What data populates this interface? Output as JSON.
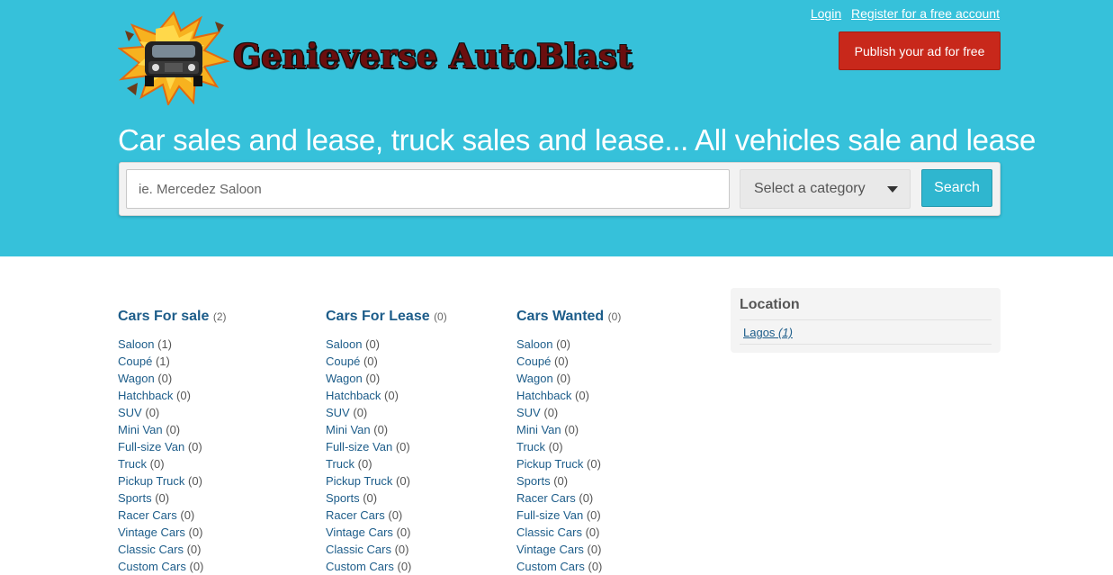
{
  "header": {
    "logo_text": "Genieverse AutoBlast",
    "links": {
      "login": "Login",
      "register": "Register for a free account"
    },
    "publish_label": "Publish your ad for free",
    "tagline": "Car sales and lease, truck sales and lease... All vehicles sale and lease"
  },
  "search": {
    "placeholder": "ie. Mercedez Saloon",
    "category_label": "Select a category",
    "button_label": "Search"
  },
  "categories": [
    {
      "title": "Cars For sale",
      "count": "(2)",
      "items": [
        {
          "label": "Saloon",
          "count": "(1)"
        },
        {
          "label": "Coupé",
          "count": "(1)"
        },
        {
          "label": "Wagon",
          "count": "(0)"
        },
        {
          "label": "Hatchback",
          "count": "(0)"
        },
        {
          "label": "SUV",
          "count": "(0)"
        },
        {
          "label": "Mini Van",
          "count": "(0)"
        },
        {
          "label": "Full-size Van",
          "count": "(0)"
        },
        {
          "label": "Truck",
          "count": "(0)"
        },
        {
          "label": "Pickup Truck",
          "count": "(0)"
        },
        {
          "label": "Sports",
          "count": "(0)"
        },
        {
          "label": "Racer Cars",
          "count": "(0)"
        },
        {
          "label": "Vintage Cars",
          "count": "(0)"
        },
        {
          "label": "Classic Cars",
          "count": "(0)"
        },
        {
          "label": "Custom Cars",
          "count": "(0)"
        }
      ]
    },
    {
      "title": "Cars For Lease",
      "count": "(0)",
      "items": [
        {
          "label": "Saloon",
          "count": "(0)"
        },
        {
          "label": "Coupé",
          "count": "(0)"
        },
        {
          "label": "Wagon",
          "count": "(0)"
        },
        {
          "label": "Hatchback",
          "count": "(0)"
        },
        {
          "label": "SUV",
          "count": "(0)"
        },
        {
          "label": "Mini Van",
          "count": "(0)"
        },
        {
          "label": "Full-size Van",
          "count": "(0)"
        },
        {
          "label": "Truck",
          "count": "(0)"
        },
        {
          "label": "Pickup Truck",
          "count": "(0)"
        },
        {
          "label": "Sports",
          "count": "(0)"
        },
        {
          "label": "Racer Cars",
          "count": "(0)"
        },
        {
          "label": "Vintage Cars",
          "count": "(0)"
        },
        {
          "label": "Classic Cars",
          "count": "(0)"
        },
        {
          "label": "Custom Cars",
          "count": "(0)"
        }
      ]
    },
    {
      "title": "Cars Wanted",
      "count": "(0)",
      "items": [
        {
          "label": "Saloon",
          "count": "(0)"
        },
        {
          "label": "Coupé",
          "count": "(0)"
        },
        {
          "label": "Wagon",
          "count": "(0)"
        },
        {
          "label": "Hatchback",
          "count": "(0)"
        },
        {
          "label": "SUV",
          "count": "(0)"
        },
        {
          "label": "Mini Van",
          "count": "(0)"
        },
        {
          "label": "Truck",
          "count": "(0)"
        },
        {
          "label": "Pickup Truck",
          "count": "(0)"
        },
        {
          "label": "Sports",
          "count": "(0)"
        },
        {
          "label": "Racer Cars",
          "count": "(0)"
        },
        {
          "label": "Full-size Van",
          "count": "(0)"
        },
        {
          "label": "Classic Cars",
          "count": "(0)"
        },
        {
          "label": "Vintage Cars",
          "count": "(0)"
        },
        {
          "label": "Custom Cars",
          "count": "(0)"
        }
      ]
    }
  ],
  "location": {
    "title": "Location",
    "items": [
      {
        "label": "Lagos",
        "count": "(1)"
      }
    ]
  },
  "colors": {
    "header_bg": "#36c1da",
    "publish_bg": "#c8281b",
    "search_btn_bg": "#2fb6cf",
    "link": "#1d5d8a"
  }
}
